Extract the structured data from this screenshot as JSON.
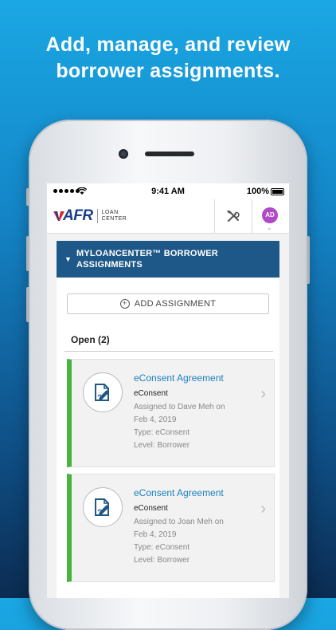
{
  "headline": {
    "line1": "Add, manage, and review",
    "line2": "borrower assignments."
  },
  "status_bar": {
    "time": "9:41 AM",
    "battery": "100%"
  },
  "app_header": {
    "logo_text": "AFR",
    "logo_sub_line1": "LOAN",
    "logo_sub_line2": "CENTER",
    "avatar_initials": "AD",
    "avatar_color": "#b048c8",
    "brand_blue": "#1b3f8a",
    "brand_red": "#d8282f"
  },
  "panel": {
    "title": "MYLOANCENTER™ BORROWER ASSIGNMENTS",
    "header_color": "#1e5888",
    "add_button_label": "ADD ASSIGNMENT",
    "section_label": "Open (2)"
  },
  "assignments": [
    {
      "title": "eConsent Agreement",
      "subtitle": "eConsent",
      "assigned_line1": "Assigned to Dave Meh on",
      "assigned_line2": "Feb 4, 2019",
      "type": "Type: eConsent",
      "level": "Level: Borrower",
      "status_color": "#46b43d",
      "icon": "document-signature-icon"
    },
    {
      "title": "eConsent Agreement",
      "subtitle": "eConsent",
      "assigned_line1": "Assigned to Joan Meh on",
      "assigned_line2": "Feb 4, 2019",
      "type": "Type: eConsent",
      "level": "Level: Borrower",
      "status_color": "#46b43d",
      "icon": "document-signature-icon"
    }
  ]
}
